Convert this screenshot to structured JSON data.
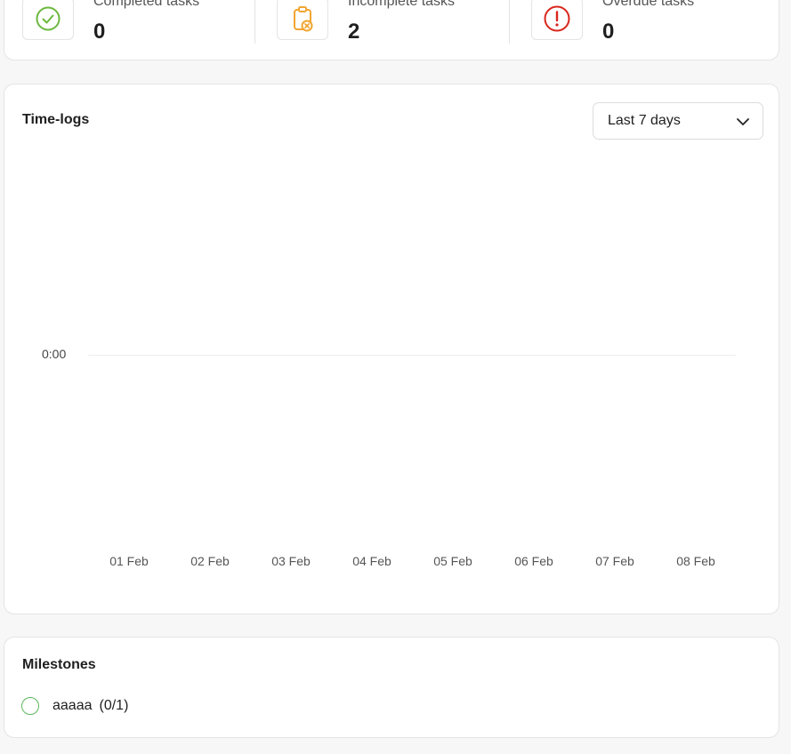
{
  "stats": [
    {
      "label": "Completed tasks",
      "value": "0",
      "icon": "check-circle-icon",
      "color": "#6bb83e"
    },
    {
      "label": "Incomplete tasks",
      "value": "2",
      "icon": "clipboard-x-icon",
      "color": "#f0a531"
    },
    {
      "label": "Overdue tasks",
      "value": "0",
      "icon": "alert-circle-icon",
      "color": "#d9261c"
    }
  ],
  "timelogs": {
    "title": "Time-logs",
    "range_select": "Last 7 days"
  },
  "chart_data": {
    "type": "bar",
    "title": "",
    "xlabel": "",
    "ylabel": "",
    "categories": [
      "01 Feb",
      "02 Feb",
      "03 Feb",
      "04 Feb",
      "05 Feb",
      "06 Feb",
      "07 Feb",
      "08 Feb"
    ],
    "values": [
      0,
      0,
      0,
      0,
      0,
      0,
      0,
      0
    ],
    "y_ticks": [
      "0:00"
    ],
    "grid": true
  },
  "milestones": {
    "title": "Milestones",
    "items": [
      {
        "name": "aaaaa",
        "count": "(0/1)"
      }
    ]
  }
}
